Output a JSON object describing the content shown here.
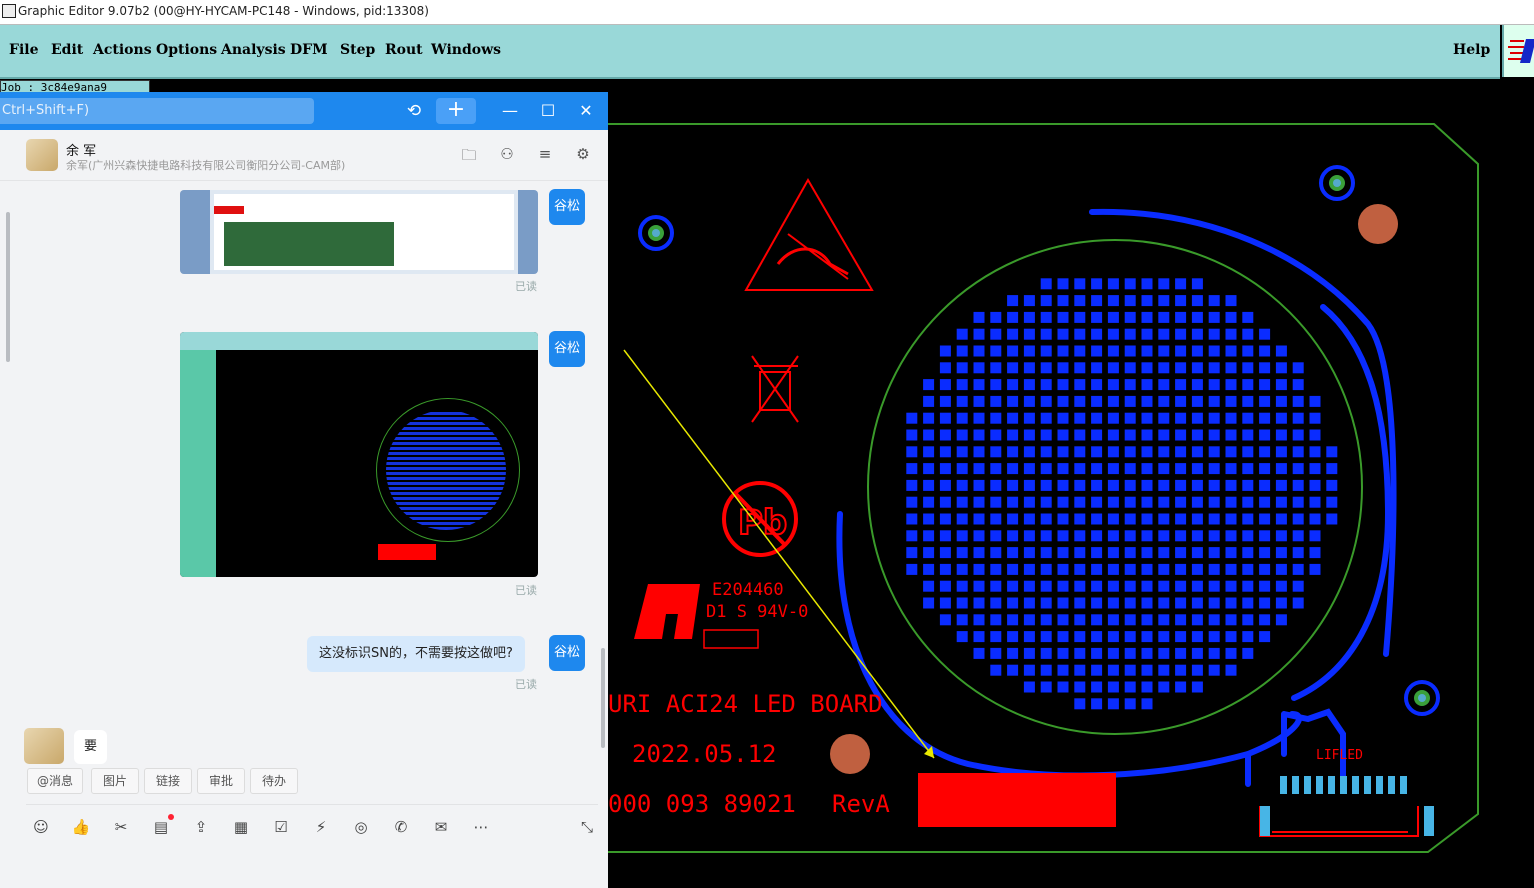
{
  "window": {
    "title": "Graphic Editor 9.07b2 (00@HY-HYCAM-PC148 - Windows, pid:13308)"
  },
  "menu": {
    "items": [
      "File",
      "Edit",
      "Actions",
      "Options",
      "Analysis",
      "DFM",
      "Step",
      "Rout",
      "Windows"
    ],
    "help": "Help"
  },
  "job_tag": "Job : 3c84e9ana9",
  "pcb": {
    "e_code": "E204460",
    "rating": "D1 S 94V-0",
    "board_name": "URI ACI24 LED BOARD",
    "date": "2022.05.12",
    "serial": "000 093 89021",
    "rev": "RevA",
    "connector_label": "LIFLED",
    "colors": {
      "outline": "#3a9a2a",
      "silk": "#ff0000",
      "copper": "#0a2cff",
      "pad": "#c06040"
    }
  },
  "chat": {
    "search_placeholder": "Ctrl+Shift+F)",
    "contact_name": "余 军",
    "contact_org": "余军(广州兴森快捷电路科技有限公司衡阳分公司-CAM部)",
    "sender_tag": "谷松",
    "read_label": "已读",
    "message_text": "这没标识SN的，不需要按这做吧?",
    "reply_text": "要",
    "quick_actions": [
      "@消息",
      "图片",
      "链接",
      "审批",
      "待办"
    ],
    "accent": "#1e88ee"
  }
}
